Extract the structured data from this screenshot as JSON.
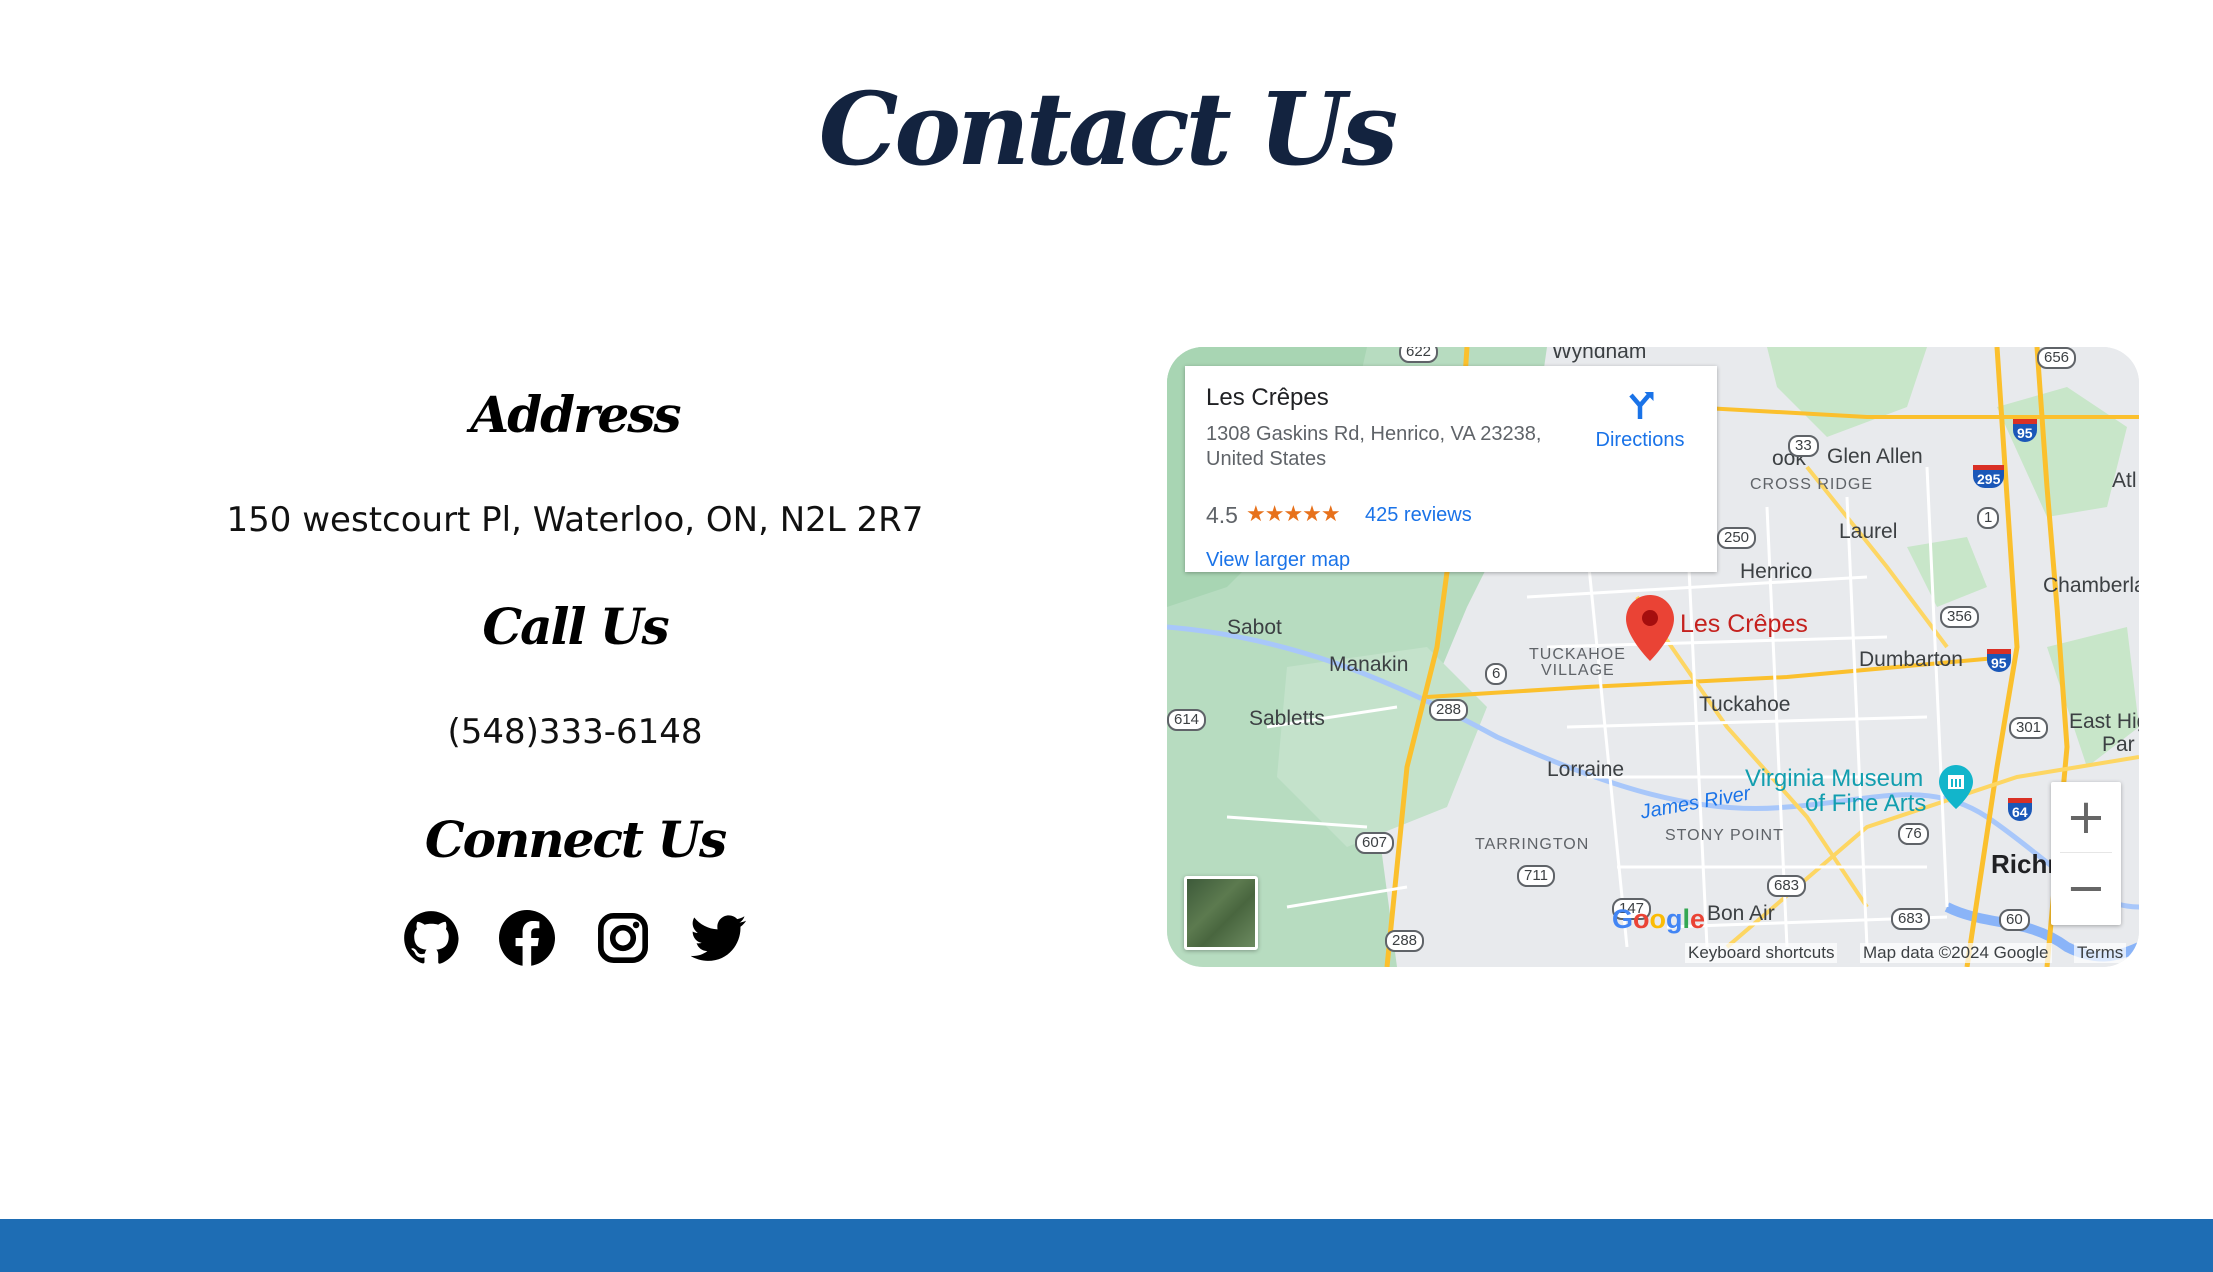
{
  "page": {
    "title": "Contact Us"
  },
  "address": {
    "heading": "Address",
    "text": "150 westcourt Pl, Waterloo, ON, N2L 2R7"
  },
  "call": {
    "heading": "Call Us",
    "phone": "(548)333-6148"
  },
  "connect": {
    "heading": "Connect Us",
    "icons": [
      "github-icon",
      "facebook-icon",
      "instagram-icon",
      "twitter-icon"
    ]
  },
  "map": {
    "place_name": "Les Crêpes",
    "place_address": "1308 Gaskins Rd, Henrico, VA 23238, United States",
    "rating": "4.5",
    "stars": "★★★★★",
    "reviews": "425 reviews",
    "directions": "Directions",
    "view_larger": "View larger map",
    "pin_label": "Les Crêpes",
    "zoom_in": "+",
    "zoom_out": "−",
    "footer": {
      "shortcuts": "Keyboard shortcuts",
      "map_data": "Map data ©2024 Google",
      "terms": "Terms"
    },
    "places": {
      "wyndham": "Wyndham",
      "glen_allen": "Glen Allen",
      "cross_ridge": "CROSS RIDGE",
      "laurel": "Laurel",
      "henrico": "Henrico",
      "chamberlayne": "Chamberlayne",
      "sabot": "Sabot",
      "manakin": "Manakin",
      "tuckahoe_village": "TUCKAHOE",
      "tuckahoe_village2": "VILLAGE",
      "dumbarton": "Dumbarton",
      "sabletts": "Sabletts",
      "tuckahoe": "Tuckahoe",
      "east_hig": "East Hig",
      "par": "Par",
      "lorraine": "Lorraine",
      "vmfa1": "Virginia Museum",
      "vmfa2": "of Fine Arts",
      "james_river": "James River",
      "tarrington": "TARRINGTON",
      "stony_point": "STONY POINT",
      "richmond": "Richm",
      "bon_air": "Bon Air",
      "ook": "ook",
      "atl": "Atl"
    },
    "shields": [
      "622",
      "656",
      "33",
      "250",
      "1",
      "356",
      "6",
      "288",
      "614",
      "301",
      "607",
      "711",
      "76",
      "683",
      "147",
      "288",
      "683",
      "60"
    ],
    "interstates": [
      "95",
      "295",
      "95",
      "64"
    ]
  },
  "colors": {
    "title": "#13233f",
    "footer_bar": "#1e6db4",
    "link": "#1a73e8",
    "pin": "#ea4335"
  }
}
